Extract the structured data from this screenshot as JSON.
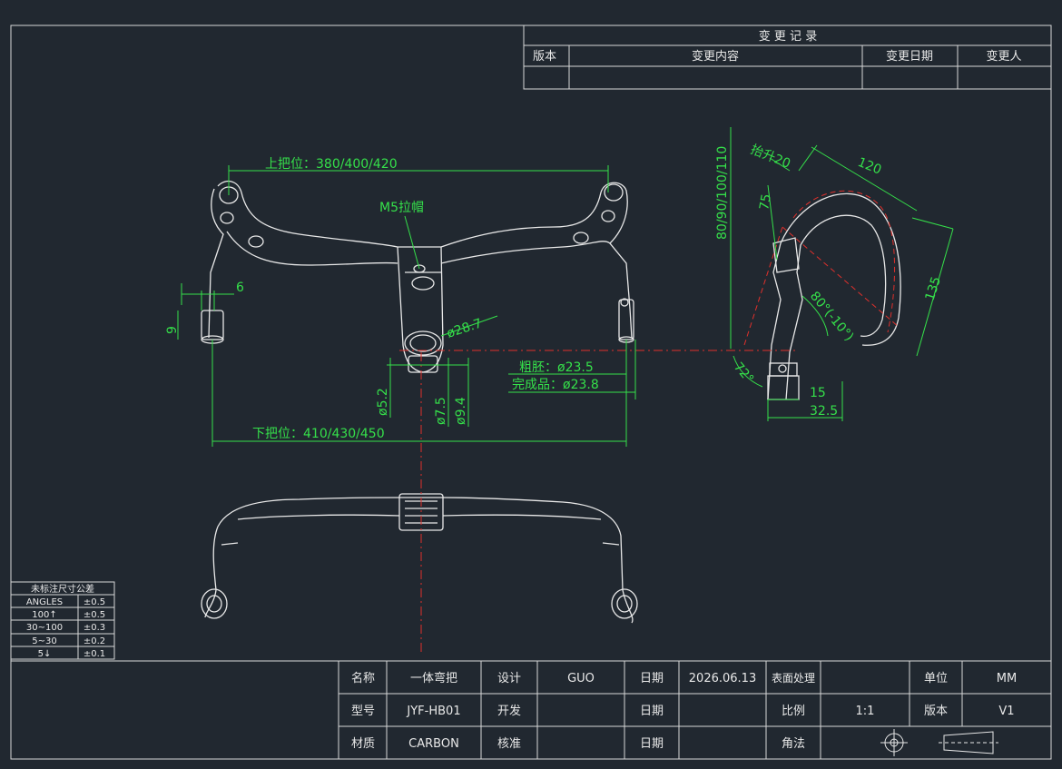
{
  "colors": {
    "background": "#212830",
    "line": "#e8e8e8",
    "dimension": "#35e04a",
    "center": "#e0302c",
    "frame": "#d8d8d8"
  },
  "revision": {
    "title": "变 更 记 录",
    "headers": [
      "版本",
      "变更内容",
      "变更日期",
      "变更人"
    ]
  },
  "dims": {
    "upper_grip": "上把位：380/400/420",
    "lower_grip": "下把位：410/430/450",
    "cap": "M5拉帽",
    "dia_28_7": "ø28.7",
    "blank": "粗胚：ø23.5",
    "finished": "完成品：ø23.8",
    "d5_2": "ø5.2",
    "d7_5": "ø7.5",
    "d9_4": "ø9.4",
    "six": "6",
    "nine": "9",
    "rise": "抬升20",
    "reach": "120",
    "stack": "80/90/100/110",
    "v75": "75",
    "v135": "135",
    "angle": "80°(-10°)",
    "a72": "72°",
    "v15": "15",
    "v32_5": "32.5"
  },
  "tolerance": {
    "title": "未标注尺寸公差",
    "rows": [
      [
        "ANGLES",
        "±0.5"
      ],
      [
        "100↑",
        "±0.5"
      ],
      [
        "30~100",
        "±0.3"
      ],
      [
        "5~30",
        "±0.2"
      ],
      [
        "5↓",
        "±0.1"
      ]
    ]
  },
  "title_block": {
    "name_label": "名称",
    "name_value": "一体弯把",
    "design_label": "设计",
    "design_value": "GUO",
    "date_label_1": "日期",
    "date_value": "2026.06.13",
    "surface_label": "表面处理",
    "unit_label": "单位",
    "unit_value": "MM",
    "model_label": "型号",
    "model_value": "JYF-HB01",
    "dev_label": "开发",
    "date_label_2": "日期",
    "scale_label": "比例",
    "scale_value": "1:1",
    "version_label": "版本",
    "version_value": "V1",
    "material_label": "材质",
    "material_value": "CARBON",
    "check_label": "核准",
    "date_label_3": "日期",
    "projection_label": "角法"
  }
}
